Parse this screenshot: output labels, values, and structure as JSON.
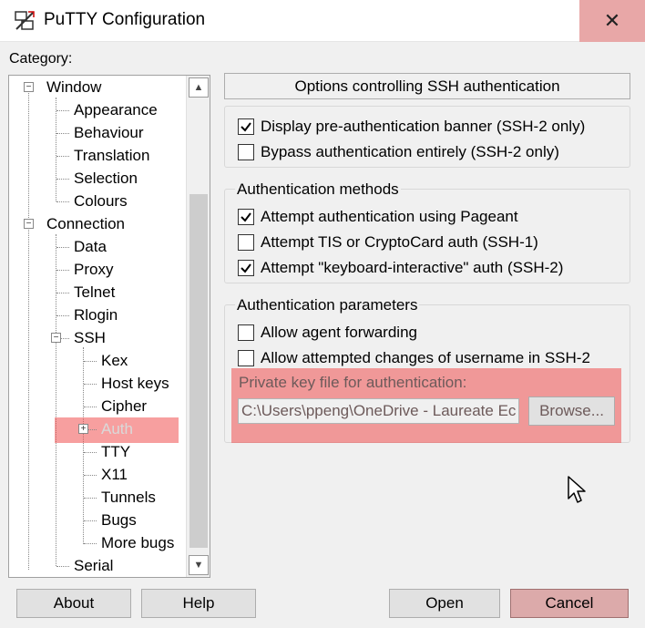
{
  "window": {
    "title": "PuTTY Configuration",
    "close_glyph": "✕",
    "title_icon": "putty-icon"
  },
  "category": {
    "label": "Category:",
    "items": [
      {
        "label": "Window",
        "level": 0,
        "expander": "−"
      },
      {
        "label": "Appearance",
        "level": 1
      },
      {
        "label": "Behaviour",
        "level": 1
      },
      {
        "label": "Translation",
        "level": 1
      },
      {
        "label": "Selection",
        "level": 1
      },
      {
        "label": "Colours",
        "level": 1
      },
      {
        "label": "Connection",
        "level": 0,
        "expander": "−"
      },
      {
        "label": "Data",
        "level": 1
      },
      {
        "label": "Proxy",
        "level": 1
      },
      {
        "label": "Telnet",
        "level": 1
      },
      {
        "label": "Rlogin",
        "level": 1
      },
      {
        "label": "SSH",
        "level": 1,
        "expander": "−"
      },
      {
        "label": "Kex",
        "level": 2
      },
      {
        "label": "Host keys",
        "level": 2
      },
      {
        "label": "Cipher",
        "level": 2
      },
      {
        "label": "Auth",
        "level": 2,
        "expander": "+",
        "selected": true
      },
      {
        "label": "TTY",
        "level": 2
      },
      {
        "label": "X11",
        "level": 2
      },
      {
        "label": "Tunnels",
        "level": 2
      },
      {
        "label": "Bugs",
        "level": 2
      },
      {
        "label": "More bugs",
        "level": 2
      },
      {
        "label": "Serial",
        "level": 1
      }
    ]
  },
  "panel": {
    "title": "Options controlling SSH authentication",
    "banner_group": [
      {
        "label": "Display pre-authentication banner (SSH-2 only)",
        "checked": true
      },
      {
        "label": "Bypass authentication entirely (SSH-2 only)",
        "checked": false
      }
    ],
    "methods": {
      "label": "Authentication methods",
      "items": [
        {
          "label": "Attempt authentication using Pageant",
          "checked": true
        },
        {
          "label": "Attempt TIS or CryptoCard auth (SSH-1)",
          "checked": false
        },
        {
          "label": "Attempt \"keyboard-interactive\" auth (SSH-2)",
          "checked": true
        }
      ]
    },
    "params": {
      "label": "Authentication parameters",
      "items": [
        {
          "label": "Allow agent forwarding",
          "checked": false
        },
        {
          "label": "Allow attempted changes of username in SSH-2",
          "checked": false
        }
      ],
      "key_label": "Private key file for authentication:",
      "key_value": "C:\\Users\\ppeng\\OneDrive - Laureate Ec",
      "browse_label": "Browse..."
    }
  },
  "buttons": {
    "about": "About",
    "help": "Help",
    "open": "Open",
    "cancel": "Cancel"
  },
  "colors": {
    "highlight": "#f05050",
    "close_bg": "#e8a7a7"
  }
}
